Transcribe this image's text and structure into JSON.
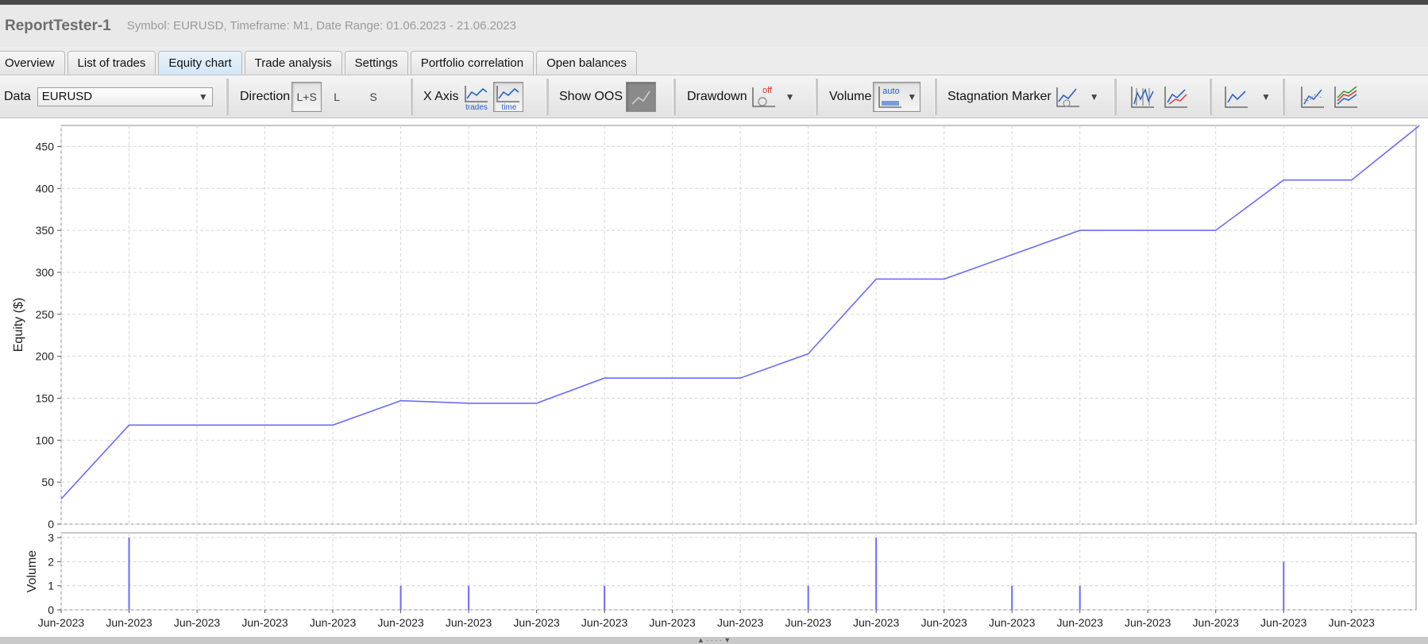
{
  "window": {
    "title": "ReportTester-1",
    "subtitle": "Symbol: EURUSD, Timeframe: M1, Date Range: 01.06.2023 - 21.06.2023"
  },
  "tabs": [
    {
      "label": "Overview"
    },
    {
      "label": "List of trades"
    },
    {
      "label": "Equity chart",
      "active": true
    },
    {
      "label": "Trade analysis"
    },
    {
      "label": "Settings"
    },
    {
      "label": "Portfolio correlation"
    },
    {
      "label": "Open balances"
    }
  ],
  "toolbar": {
    "data_label": "Data",
    "data_value": "EURUSD",
    "direction_label": "Direction",
    "direction_options": [
      "L+S",
      "L",
      "S"
    ],
    "direction_selected": "L+S",
    "xaxis_label": "X Axis",
    "xaxis_trades_label": "trades",
    "xaxis_time_label": "time",
    "xaxis_selected": "time",
    "show_oos_label": "Show OOS",
    "drawdown_label": "Drawdown",
    "drawdown_off_label": "off",
    "volume_label": "Volume",
    "volume_auto_label": "auto",
    "stagnation_label": "Stagnation Marker"
  },
  "icons": {
    "combo_arrow": "chevron-down-icon",
    "xaxis_trades": "line-chart-trades-icon",
    "xaxis_time": "line-chart-time-icon",
    "show_oos": "oos-chart-icon",
    "drawdown": "drawdown-off-icon",
    "volume": "volume-auto-icon",
    "stagnation": "stagnation-chart-icon",
    "chart_a": "multi-line-chart-icon",
    "chart_b": "red-blue-line-chart-icon",
    "chart_c": "line-chart-icon",
    "chart_d": "scatter-line-chart-icon",
    "chart_e": "multi-color-line-chart-icon"
  },
  "colors": {
    "equity_line": "#6b6bff",
    "volume_bars": "#6b6bff",
    "grid": "#d8d8d8",
    "active_tab": "#d7e9f7",
    "drawdown_off": "#e03030",
    "icon_blue": "#2a62c9"
  },
  "chart_data": [
    {
      "type": "line",
      "ylabel": "Equity ($)",
      "ylim": [
        0,
        475
      ],
      "yticks": [
        0,
        50,
        100,
        150,
        200,
        250,
        300,
        350,
        400,
        450
      ],
      "x_tick_labels": [
        "Jun-2023",
        "Jun-2023",
        "Jun-2023",
        "Jun-2023",
        "Jun-2023",
        "Jun-2023",
        "Jun-2023",
        "Jun-2023",
        "Jun-2023",
        "Jun-2023",
        "Jun-2023",
        "Jun-2023",
        "Jun-2023",
        "Jun-2023",
        "Jun-2023",
        "Jun-2023",
        "Jun-2023",
        "Jun-2023",
        "Jun-2023",
        "Jun-2023"
      ],
      "grid": true,
      "series": [
        {
          "x": [
            0,
            1,
            2,
            3,
            4,
            5,
            6,
            7,
            8,
            9,
            10,
            11,
            12,
            13,
            14,
            15,
            16,
            17,
            18,
            19,
            20
          ],
          "values": [
            30,
            118,
            118,
            118,
            118,
            147,
            144,
            144,
            174,
            174,
            174,
            203,
            292,
            292,
            321,
            350,
            350,
            350,
            410,
            410,
            475
          ]
        }
      ]
    },
    {
      "type": "bar",
      "ylabel": "Volume",
      "ylim": [
        0,
        3
      ],
      "yticks": [
        0,
        1,
        2,
        3
      ],
      "grid": true,
      "x": [
        1,
        5,
        6,
        8,
        11,
        12,
        14,
        15,
        18
      ],
      "values": [
        3,
        1,
        1,
        1,
        1,
        3,
        1,
        1,
        2
      ]
    }
  ]
}
